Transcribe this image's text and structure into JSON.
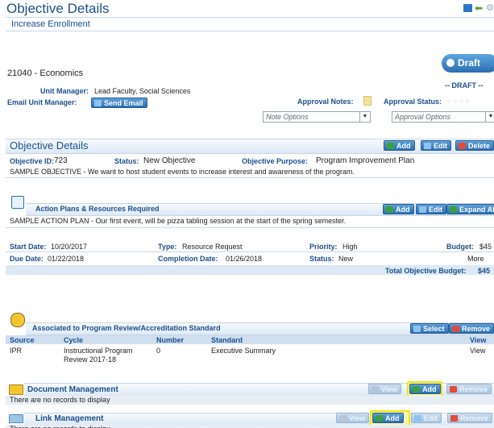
{
  "header": {
    "title": "Objective Details",
    "subtitle": "Increase Enrollment"
  },
  "unit": {
    "name": "21040 - Economics",
    "manager_label": "Unit Manager:",
    "manager_value": "Lead Faculty, Social Sciences",
    "email_label": "Email Unit Manager:",
    "send_email": "Send Email"
  },
  "draft": {
    "button": "Draft",
    "status": "-- DRAFT --"
  },
  "approval": {
    "notes_label": "Approval Notes:",
    "status_label": "Approval Status:",
    "note_options": "Note Options",
    "approval_options": "Approval Options"
  },
  "objective": {
    "section_title": "Objective Details",
    "add": "Add",
    "edit": "Edit",
    "delete": "Delete",
    "id_label": "Objective ID:",
    "id_value": "723",
    "status_label": "Status:",
    "status_value": "New Objective",
    "purpose_label": "Objective Purpose:",
    "purpose_value": "Program Improvement Plan",
    "description": "SAMPLE OBJECTIVE - We want to host student events to increase interest and awareness of the program."
  },
  "action_plans": {
    "title": "Action Plans & Resources Required",
    "add": "Add",
    "edit": "Edit",
    "expand": "Expand All",
    "description": "SAMPLE ACTION PLAN - Our first event, will be pizza tabling session at the start of the spring semester.",
    "start_label": "Start Date:",
    "start_value": "10/20/2017",
    "type_label": "Type:",
    "type_value": "Resource Request",
    "priority_label": "Priority:",
    "priority_value": "High",
    "budget_label": "Budget:",
    "budget_value": "$45",
    "due_label": "Due Date:",
    "due_value": "01/22/2018",
    "completion_label": "Completion Date:",
    "completion_value": "01/26/2018",
    "status_label": "Status:",
    "status_value": "New",
    "more": "More >>",
    "total_label": "Total Objective Budget:",
    "total_value": "$45"
  },
  "standards": {
    "title": "Associated to Program Review/Accreditation Standard",
    "select": "Select",
    "remove": "Remove",
    "columns": [
      "Source",
      "Cycle",
      "Number",
      "Standard",
      "View"
    ],
    "row": {
      "source": "IPR",
      "cycle_line1": "Instructional Program",
      "cycle_line2": "Review 2017-18",
      "number": "0",
      "standard": "Executive Summary",
      "view": "View"
    }
  },
  "documents": {
    "title": "Document Management",
    "view": "View",
    "add": "Add",
    "remove": "Remove",
    "empty": "There are no records to display"
  },
  "links": {
    "title": "Link Management",
    "view": "View",
    "add": "Add",
    "edit": "Edit",
    "remove": "Remove",
    "empty": "There are no records to display"
  },
  "colors": {
    "accent": "#2a6fb3",
    "highlight": "#f2e600",
    "title": "#1c4f8a"
  }
}
